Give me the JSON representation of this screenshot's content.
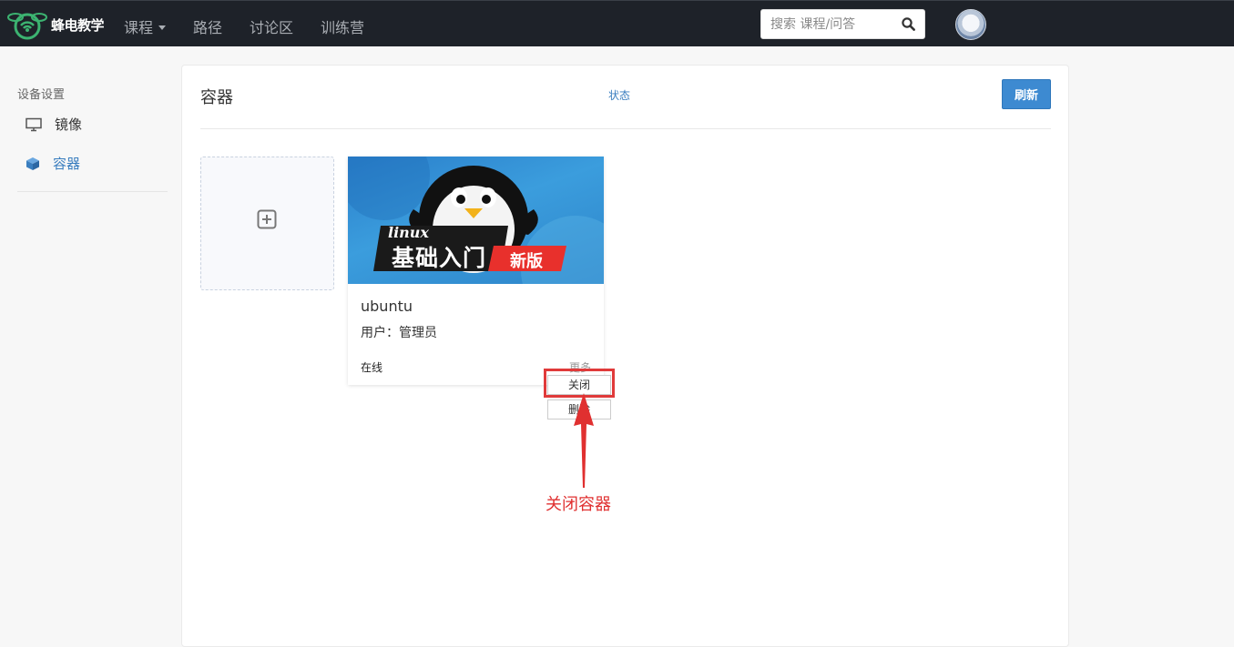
{
  "brand": {
    "name": "蜂电教学",
    "accent": "#3cb371"
  },
  "nav": {
    "items": [
      {
        "label": "课程",
        "has_caret": true
      },
      {
        "label": "路径"
      },
      {
        "label": "讨论区"
      },
      {
        "label": "训练营"
      }
    ]
  },
  "search": {
    "placeholder": "搜索 课程/问答",
    "icon": "search-icon"
  },
  "sidebar": {
    "heading": "设备设置",
    "items": [
      {
        "label": "镜像",
        "icon": "monitor-icon",
        "active": false
      },
      {
        "label": "容器",
        "icon": "cube-icon",
        "active": true,
        "color": "#3a7ebf"
      }
    ]
  },
  "main": {
    "title": "容器",
    "status_link": "状态",
    "refresh_label": "刷新",
    "add_icon": "plus-square-icon",
    "container": {
      "cover_text_1": "linux",
      "cover_text_2": "基础入门",
      "cover_text_3": "新版",
      "name": "ubuntu",
      "user": "用户：管理员",
      "status": "在线",
      "more_label": "更多",
      "menu": [
        "关闭",
        "删除"
      ]
    }
  },
  "annotation": {
    "text": "关闭容器",
    "color": "#e03030"
  }
}
